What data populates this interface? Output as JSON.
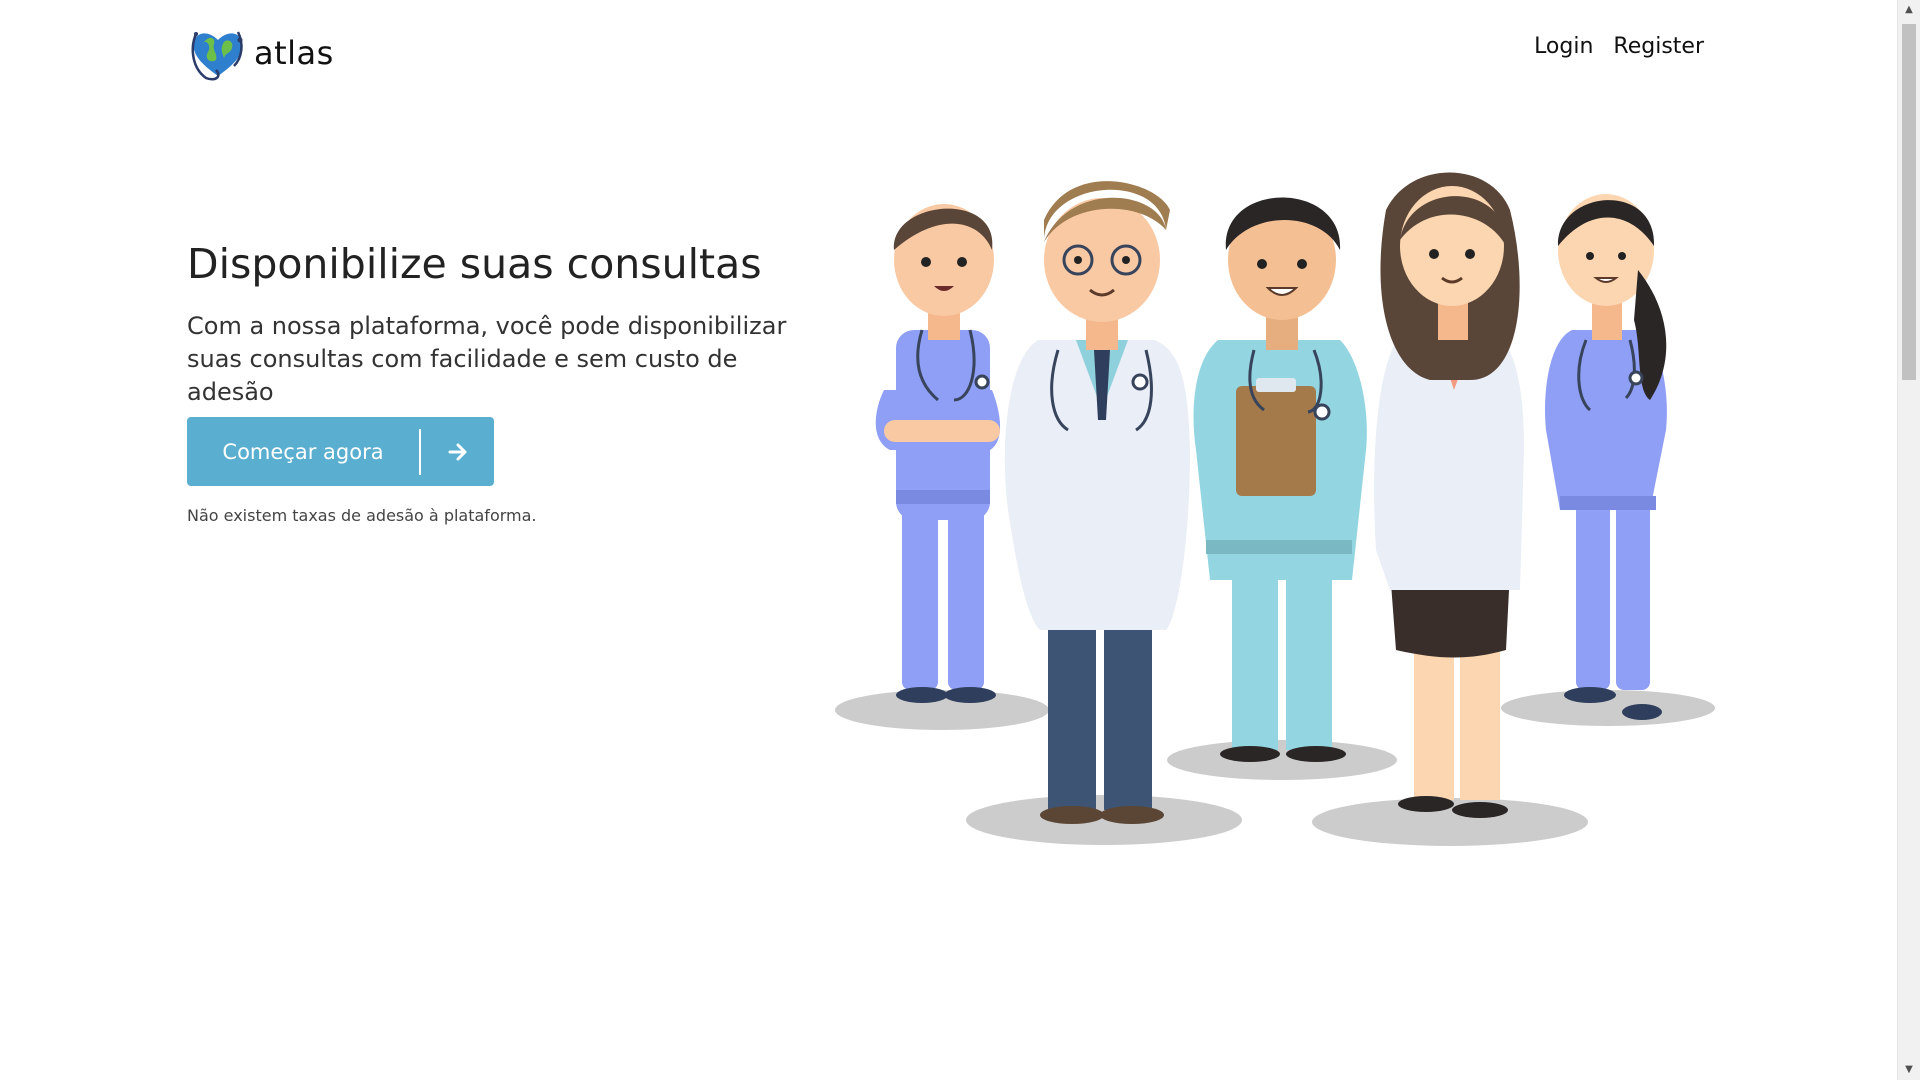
{
  "brand": {
    "name": "atlas",
    "logo_icon": "globe-heart-stethoscope-icon"
  },
  "nav": {
    "login": "Login",
    "register": "Register"
  },
  "hero": {
    "title": "Disponibilize suas consultas",
    "subtitle": "Com a nossa plataforma, você pode disponibilizar suas consultas com facilidade e sem custo de adesão",
    "cta_label": "Começar agora",
    "cta_icon": "arrow-right-icon",
    "note": "Não existem taxas de adesão à plataforma."
  },
  "illustration": {
    "subject": "medical-team",
    "colors": {
      "scrubs": "#8f9ff5",
      "teal_scrubs": "#93d5e0",
      "coat": "#e9eef7",
      "trousers": "#3e5474",
      "shadow": "#cccccc"
    }
  },
  "theme": {
    "accent": "#5aaed0",
    "text": "#222222"
  }
}
